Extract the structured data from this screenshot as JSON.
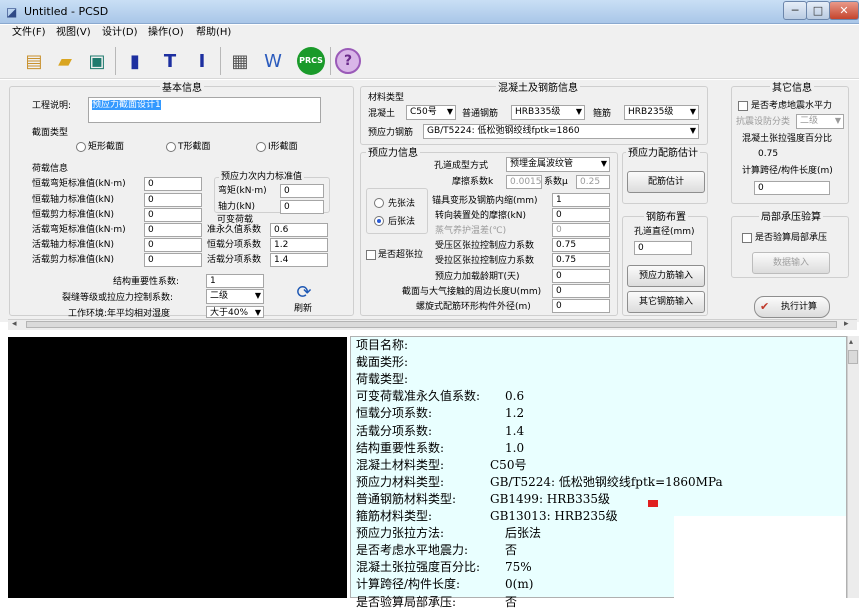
{
  "window": {
    "title": "Untitled - PCSD",
    "min": "─",
    "max": "□",
    "close": "✕"
  },
  "menu": [
    "文件(F)",
    "视图(V)",
    "设计(D)",
    "操作(O)",
    "帮助(H)"
  ],
  "toolbar": {
    "prcs": "PRCS",
    "help": "?"
  },
  "basic": {
    "header": "基本信息",
    "project_label": "工程说明:",
    "project_value": "预应力截面设计1",
    "section_label": "截面类型",
    "sections": [
      "矩形截面",
      "T形截面",
      "I形截面"
    ],
    "loads_header": "荷载信息",
    "loads": [
      {
        "label": "恒载弯矩标准值(kN·m)",
        "value": "0"
      },
      {
        "label": "恒载轴力标准值(kN)",
        "value": "0"
      },
      {
        "label": "恒载剪力标准值(kN)",
        "value": "0"
      },
      {
        "label": "活载弯矩标准值(kN·m)",
        "value": "0"
      },
      {
        "label": "活载轴力标准值(kN)",
        "value": "0"
      },
      {
        "label": "活载剪力标准值(kN)",
        "value": "0"
      }
    ],
    "prestress_header": "预应力次内力标准值",
    "pre_moment_label": "弯矩(kN·m)",
    "pre_moment": "0",
    "pre_axial_label": "轴力(kN)",
    "pre_axial": "0",
    "variable_label": "可变荷载",
    "variable_quasi_label": "准永久值系数",
    "variable_quasi": "0.6",
    "dead_factor_label": "恒载分项系数",
    "dead_factor": "1.2",
    "live_factor_label": "活载分项系数",
    "live_factor": "1.4",
    "importance_label": "结构重要性系数:",
    "importance": "1",
    "crack_label": "裂缝等级或拉应力控制系数:",
    "crack": "二级",
    "env_label": "工作环境:年平均相对湿度",
    "env": "大于40%",
    "refresh": "刷新"
  },
  "material": {
    "header": "混凝土及钢筋信息",
    "type_label": "材料类型",
    "concrete_label": "混凝土",
    "concrete": "C50号",
    "rebar_label": "普通钢筋",
    "rebar": "HRB335级",
    "stirrup_label": "箍筋",
    "stirrup": "HRB235级",
    "pre_steel_label": "预应力钢筋",
    "pre_steel": "GB/T5224: 低松弛钢绞线fptk=1860"
  },
  "prestress_info": {
    "header": "预应力信息",
    "duct_label": "孔道成型方式",
    "duct": "预埋金属波纹管",
    "friction_label": "摩擦系数k",
    "friction_k": "0.0015",
    "mu_label": "系数μ",
    "mu": "0.25",
    "pretension": "先张法",
    "posttension": "后张法",
    "over_tension": "是否超张拉",
    "rows": [
      {
        "label": "锚具变形及钢筋内缩(mm)",
        "value": "1",
        "disabled": false
      },
      {
        "label": "转向装置处的摩擦(kN)",
        "value": "0",
        "disabled": false
      },
      {
        "label": "蒸气养护温差(℃)",
        "value": "0",
        "disabled": true
      },
      {
        "label": "受压区张拉控制应力系数",
        "value": "0.75",
        "disabled": false
      },
      {
        "label": "受拉区张拉控制应力系数",
        "value": "0.75",
        "disabled": false
      },
      {
        "label": "预应力加载龄期T(天)",
        "value": "0",
        "disabled": false
      },
      {
        "label": "截面与大气接触的周边长度U(mm)",
        "value": "0",
        "disabled": false
      },
      {
        "label": "螺旋式配筋环形构件外径(m)",
        "value": "0",
        "disabled": false
      }
    ]
  },
  "estimate": {
    "header": "预应力配筋估计",
    "estimate_btn": "配筋估计",
    "layout_header": "钢筋布置",
    "duct_dia_label": "孔道直径(mm)",
    "duct_dia": "0",
    "pre_input_btn": "预应力筋输入",
    "other_input_btn": "其它钢筋输入"
  },
  "other": {
    "header": "其它信息",
    "seismic_label": "是否考虑地震水平力",
    "seismic_grade_label": "抗震设防分类",
    "seismic_grade": "二级",
    "tension_pct_label": "混凝土张拉强度百分比",
    "tension_pct": "0.75",
    "span_label": "计算跨径/构件长度(m)",
    "span": "0",
    "local_header": "局部承压验算",
    "local_label": "是否验算局部承压",
    "data_input": "数据输入",
    "execute": "执行计算"
  },
  "report": [
    {
      "k": "项目名称:",
      "v": ""
    },
    {
      "k": "截面类形:",
      "v": ""
    },
    {
      "k": "荷载类型:",
      "v": ""
    },
    {
      "k": "可变荷载准永久值系数:",
      "v": "0.6"
    },
    {
      "k": "恒载分项系数:",
      "v": "1.2"
    },
    {
      "k": "活载分项系数:",
      "v": "1.4"
    },
    {
      "k": "结构重要性系数:",
      "v": "1.0"
    },
    {
      "k": "混凝土材料类型:",
      "v": "C50号"
    },
    {
      "k": "预应力材料类型:",
      "v": "GB/T5224: 低松弛钢绞线fptk=1860MPa"
    },
    {
      "k": "普通钢筋材料类型:",
      "v": "GB1499: HRB335级"
    },
    {
      "k": "箍筋材料类型:",
      "v": "GB13013: HRB235级"
    },
    {
      "k": "预应力张拉方法:",
      "v": "后张法"
    },
    {
      "k": "是否考虑水平地震力:",
      "v": "否"
    },
    {
      "k": "混凝土张拉强度百分比:",
      "v": "75%"
    },
    {
      "k": "计算跨径/构件长度:",
      "v": "0(m)"
    },
    {
      "k": "是否验算局部承压:",
      "v": "否"
    }
  ]
}
